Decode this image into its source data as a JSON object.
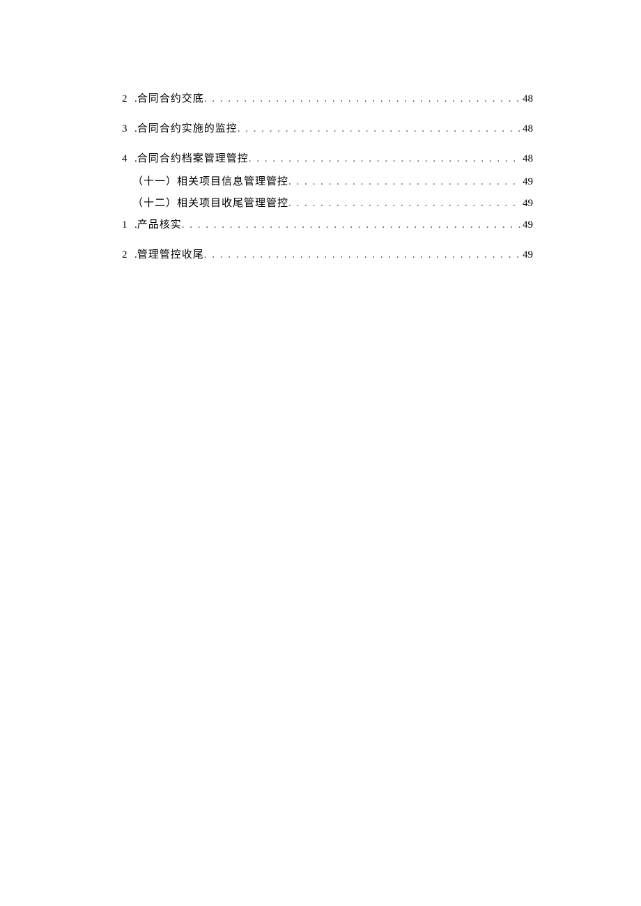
{
  "toc": [
    {
      "kind": "numbered",
      "number": "2",
      "sep": " .",
      "title": "合同合约交底",
      "page": "48"
    },
    {
      "kind": "numbered",
      "number": "3",
      "sep": " .",
      "title": "合同合约实施的监控",
      "page": "48"
    },
    {
      "kind": "numbered",
      "number": "4",
      "sep": " .",
      "title": "合同合约档案管理管控",
      "page": "48",
      "tight": true
    },
    {
      "kind": "section",
      "title": "（十一）相关项目信息管理管控 ",
      "page": "49"
    },
    {
      "kind": "section",
      "title": "（十二）相关项目收尾管理管控 ",
      "page": "49"
    },
    {
      "kind": "numbered",
      "number": "1",
      "sep": " .",
      "title": "产品核实",
      "page": "49"
    },
    {
      "kind": "numbered",
      "number": "2",
      "sep": " .",
      "title": "管理管控收尾",
      "page": "49"
    }
  ]
}
